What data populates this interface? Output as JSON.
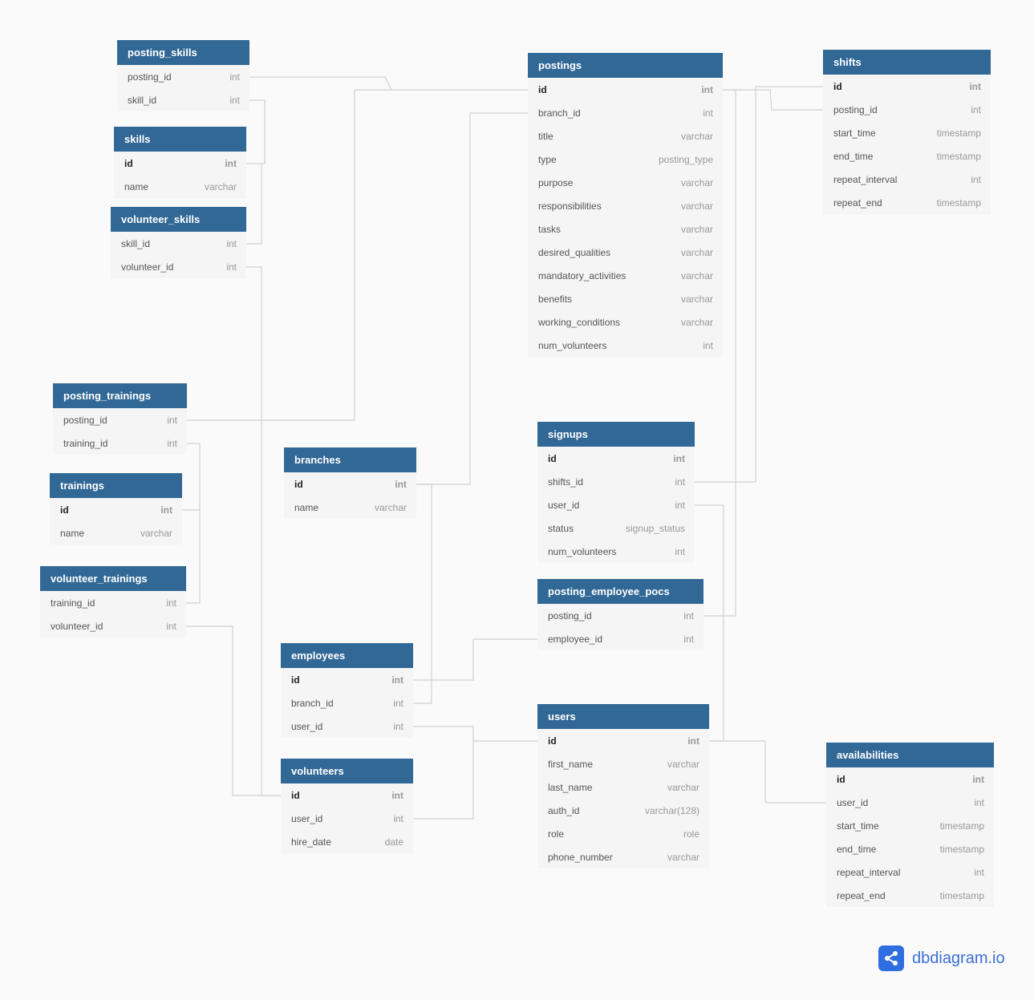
{
  "tables": [
    {
      "name": "posting_skills",
      "fields": [
        {
          "name": "posting_id",
          "type": "int"
        },
        {
          "name": "skill_id",
          "type": "int"
        }
      ]
    },
    {
      "name": "skills",
      "fields": [
        {
          "name": "id",
          "type": "int",
          "pk": true
        },
        {
          "name": "name",
          "type": "varchar"
        }
      ]
    },
    {
      "name": "volunteer_skills",
      "fields": [
        {
          "name": "skill_id",
          "type": "int"
        },
        {
          "name": "volunteer_id",
          "type": "int"
        }
      ]
    },
    {
      "name": "postings",
      "fields": [
        {
          "name": "id",
          "type": "int",
          "pk": true
        },
        {
          "name": "branch_id",
          "type": "int"
        },
        {
          "name": "title",
          "type": "varchar"
        },
        {
          "name": "type",
          "type": "posting_type"
        },
        {
          "name": "purpose",
          "type": "varchar"
        },
        {
          "name": "responsibilities",
          "type": "varchar"
        },
        {
          "name": "tasks",
          "type": "varchar"
        },
        {
          "name": "desired_qualities",
          "type": "varchar"
        },
        {
          "name": "mandatory_activities",
          "type": "varchar"
        },
        {
          "name": "benefits",
          "type": "varchar"
        },
        {
          "name": "working_conditions",
          "type": "varchar"
        },
        {
          "name": "num_volunteers",
          "type": "int"
        }
      ]
    },
    {
      "name": "shifts",
      "fields": [
        {
          "name": "id",
          "type": "int",
          "pk": true
        },
        {
          "name": "posting_id",
          "type": "int"
        },
        {
          "name": "start_time",
          "type": "timestamp"
        },
        {
          "name": "end_time",
          "type": "timestamp"
        },
        {
          "name": "repeat_interval",
          "type": "int"
        },
        {
          "name": "repeat_end",
          "type": "timestamp"
        }
      ]
    },
    {
      "name": "posting_trainings",
      "fields": [
        {
          "name": "posting_id",
          "type": "int"
        },
        {
          "name": "training_id",
          "type": "int"
        }
      ]
    },
    {
      "name": "trainings",
      "fields": [
        {
          "name": "id",
          "type": "int",
          "pk": true
        },
        {
          "name": "name",
          "type": "varchar"
        }
      ]
    },
    {
      "name": "volunteer_trainings",
      "fields": [
        {
          "name": "training_id",
          "type": "int"
        },
        {
          "name": "volunteer_id",
          "type": "int"
        }
      ]
    },
    {
      "name": "branches",
      "fields": [
        {
          "name": "id",
          "type": "int",
          "pk": true
        },
        {
          "name": "name",
          "type": "varchar"
        }
      ]
    },
    {
      "name": "signups",
      "fields": [
        {
          "name": "id",
          "type": "int",
          "pk": true
        },
        {
          "name": "shifts_id",
          "type": "int"
        },
        {
          "name": "user_id",
          "type": "int"
        },
        {
          "name": "status",
          "type": "signup_status"
        },
        {
          "name": "num_volunteers",
          "type": "int"
        }
      ]
    },
    {
      "name": "posting_employee_pocs",
      "fields": [
        {
          "name": "posting_id",
          "type": "int"
        },
        {
          "name": "employee_id",
          "type": "int"
        }
      ]
    },
    {
      "name": "employees",
      "fields": [
        {
          "name": "id",
          "type": "int",
          "pk": true
        },
        {
          "name": "branch_id",
          "type": "int"
        },
        {
          "name": "user_id",
          "type": "int"
        }
      ]
    },
    {
      "name": "users",
      "fields": [
        {
          "name": "id",
          "type": "int",
          "pk": true
        },
        {
          "name": "first_name",
          "type": "varchar"
        },
        {
          "name": "last_name",
          "type": "varchar"
        },
        {
          "name": "auth_id",
          "type": "varchar(128)"
        },
        {
          "name": "role",
          "type": "role"
        },
        {
          "name": "phone_number",
          "type": "varchar"
        }
      ]
    },
    {
      "name": "volunteers",
      "fields": [
        {
          "name": "id",
          "type": "int",
          "pk": true
        },
        {
          "name": "user_id",
          "type": "int"
        },
        {
          "name": "hire_date",
          "type": "date"
        }
      ]
    },
    {
      "name": "availabilities",
      "fields": [
        {
          "name": "id",
          "type": "int",
          "pk": true
        },
        {
          "name": "user_id",
          "type": "int"
        },
        {
          "name": "start_time",
          "type": "timestamp"
        },
        {
          "name": "end_time",
          "type": "timestamp"
        },
        {
          "name": "repeat_interval",
          "type": "int"
        },
        {
          "name": "repeat_end",
          "type": "timestamp"
        }
      ]
    }
  ],
  "colors": {
    "header": "#316896",
    "row_bg": "#f5f5f5",
    "background": "#fafafa",
    "link": "#d0d0d0",
    "brand": "#2f6ee0"
  },
  "branding": {
    "logo_text": "dbdiagram.io",
    "icon": "share-nodes-icon"
  }
}
